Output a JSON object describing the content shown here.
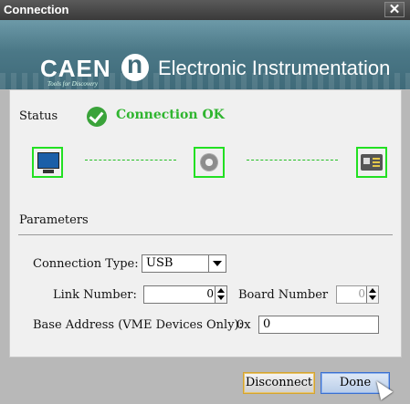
{
  "window": {
    "title": "Connection",
    "close_glyph": "✕"
  },
  "banner": {
    "logo": "CAEN",
    "logo_tagline": "Tools for Discovery",
    "product_text": "Electronic Instrumentation"
  },
  "status": {
    "label": "Status",
    "text": "Connection OK",
    "icon": "check-circle-icon",
    "color": "#2fb52f"
  },
  "devices": [
    "computer-icon",
    "gear-icon",
    "instrument-icon"
  ],
  "parameters": {
    "heading": "Parameters",
    "connection_type_label": "Connection Type:",
    "connection_type_value": "USB",
    "link_number_label": "Link Number:",
    "link_number_value": "0",
    "board_number_label": "Board Number",
    "board_number_value": "0",
    "base_address_label": "Base Address (VME Devices Only):",
    "base_address_prefix": "0x",
    "base_address_value": "0"
  },
  "buttons": {
    "disconnect": "Disconnect",
    "done": "Done"
  }
}
